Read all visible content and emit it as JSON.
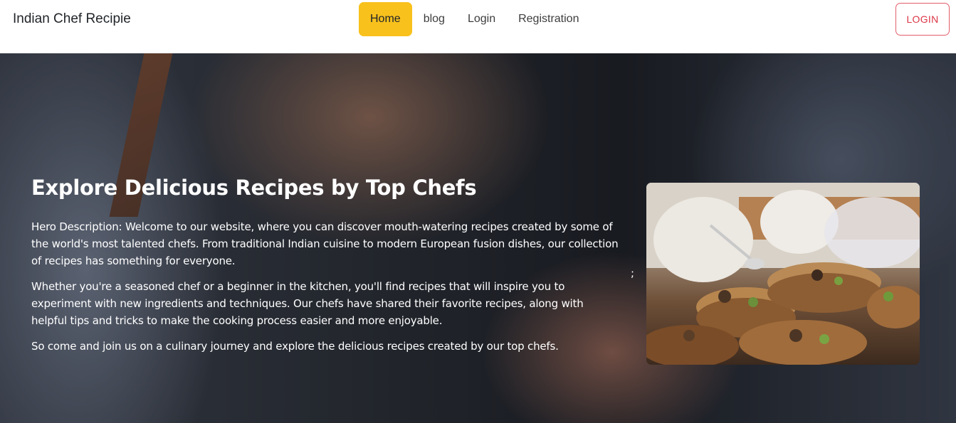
{
  "navbar": {
    "brand": "Indian Chef Recipie",
    "links": [
      "Home",
      "blog",
      "Login",
      "Registration"
    ],
    "active_index": 0,
    "login_button": "LOGIN"
  },
  "hero": {
    "title": "Explore Delicious Recipes by Top Chefs",
    "paragraphs": [
      "Hero Description: Welcome to our website, where you can discover mouth-watering recipes created by some of the world's most talented chefs. From traditional Indian cuisine to modern European fusion dishes, our collection of recipes has something for everyone.",
      "Whether you're a seasoned chef or a beginner in the kitchen, you'll find recipes that will inspire you to experiment with new ingredients and techniques. Our chefs have shared their favorite recipes, along with helpful tips and tricks to make the cooking process easier and more enjoyable.",
      "So come and join us on a culinary journey and explore the delicious recipes created by our top chefs."
    ],
    "stray_text": ";"
  },
  "colors": {
    "accent": "#f8c11c",
    "login_border": "#e35d6a",
    "login_text": "#dc3545"
  }
}
